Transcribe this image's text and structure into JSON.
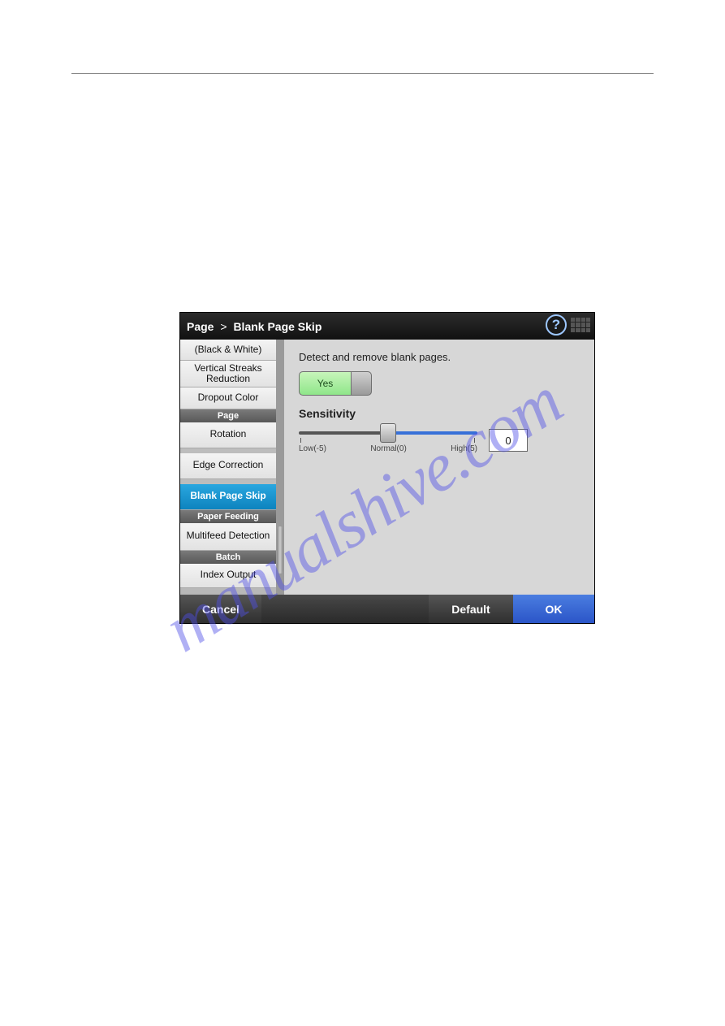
{
  "page_meta": {
    "number": "",
    "section": ""
  },
  "watermark": "manualshive.com",
  "titlebar": {
    "crumb_root": "Page",
    "crumb_sep": ">",
    "crumb_current": "Blank Page Skip"
  },
  "sidebar": {
    "items_top": [
      {
        "label": "(Black & White)"
      },
      {
        "label": "Vertical Streaks Reduction"
      },
      {
        "label": "Dropout Color"
      }
    ],
    "hdr_page": "Page",
    "items_page": [
      {
        "label": "Rotation"
      },
      {
        "label": "Edge Correction"
      },
      {
        "label": "Blank Page Skip",
        "active": true
      }
    ],
    "hdr_feed": "Paper Feeding",
    "items_feed": [
      {
        "label": "Multifeed Detection"
      }
    ],
    "hdr_batch": "Batch",
    "items_batch": [
      {
        "label": "Index Output"
      }
    ]
  },
  "content": {
    "description": "Detect and remove blank pages.",
    "toggle_label": "Yes",
    "sensitivity_label": "Sensitivity",
    "slider": {
      "low": "Low(-5)",
      "normal": "Normal(0)",
      "high": "High(5)",
      "value": "0"
    }
  },
  "footer": {
    "cancel": "Cancel",
    "default": "Default",
    "ok": "OK"
  }
}
